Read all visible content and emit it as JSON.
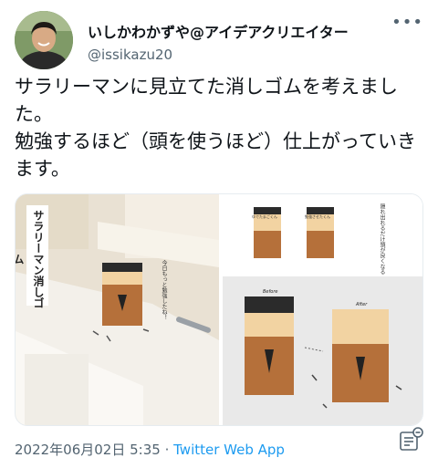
{
  "user": {
    "display_name": "いしかわかずや@アイデアクリエイター",
    "handle": "@issikazu20",
    "avatar_icon": "user-avatar"
  },
  "tweet": {
    "text": "サラリーマンに見立てた消しゴムを考えました。\n勉強するほど（頭を使うほど）仕上がっていきます。"
  },
  "media": {
    "left_photo": {
      "banner": "サラリーマン消しゴム",
      "caption": "今日もっと勉強したね！"
    },
    "right_photo": {
      "top_left_label": "ゆでたまごくん",
      "top_right_label": "勉強させたくん",
      "note": "隠れ出れるだけ頭が良くなる",
      "before_label": "Before",
      "after_label": "After"
    }
  },
  "footer": {
    "date": "2022年06月02日 5:35",
    "separator": " · ",
    "via": "Twitter Web App"
  },
  "colors": {
    "accent": "#1d9bf0",
    "text": "#0f1419",
    "muted": "#536471"
  }
}
